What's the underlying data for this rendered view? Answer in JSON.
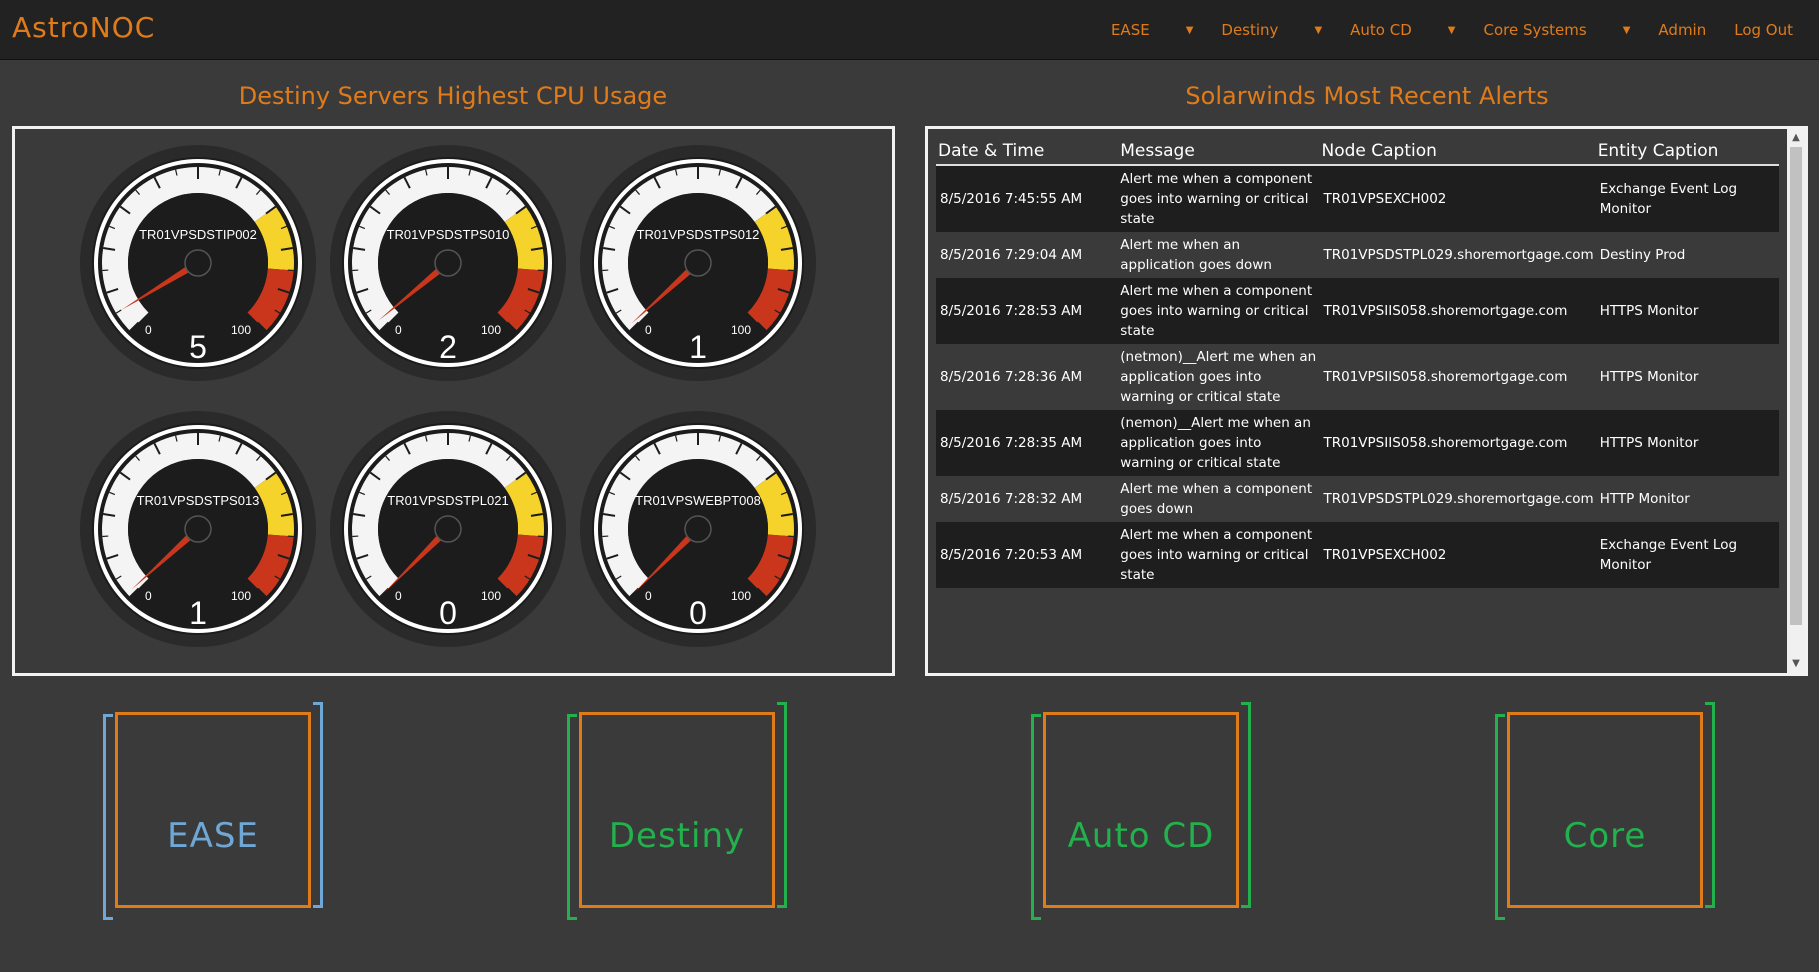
{
  "brand": "AstroNOC",
  "nav": {
    "items": [
      {
        "label": "EASE",
        "dropdown": true
      },
      {
        "label": "Destiny",
        "dropdown": true
      },
      {
        "label": "Auto CD",
        "dropdown": true
      },
      {
        "label": "Core Systems",
        "dropdown": true
      },
      {
        "label": "Admin",
        "dropdown": false
      },
      {
        "label": "Log Out",
        "dropdown": false
      }
    ],
    "caret_icon": "caret-down-icon"
  },
  "cpu_section": {
    "title": "Destiny Servers Highest CPU Usage",
    "gauge_min": "0",
    "gauge_max": "100",
    "gauges": [
      {
        "server": "TR01VPSDSTIP002",
        "value": 5
      },
      {
        "server": "TR01VPSDSTPS010",
        "value": 2
      },
      {
        "server": "TR01VPSDSTPS012",
        "value": 1
      },
      {
        "server": "TR01VPSDSTPS013",
        "value": 1
      },
      {
        "server": "TR01VPSDSTPL021",
        "value": 0
      },
      {
        "server": "TR01VPSWEBPT008",
        "value": 0
      }
    ]
  },
  "alerts_section": {
    "title": "Solarwinds Most Recent Alerts",
    "columns": [
      "Date & Time",
      "Message",
      "Node Caption",
      "Entity Caption"
    ],
    "rows": [
      {
        "datetime": "8/5/2016 7:45:55 AM",
        "message": "Alert me when a component goes into warning or critical state",
        "node": "TR01VPSEXCH002",
        "entity": "Exchange Event Log Monitor"
      },
      {
        "datetime": "8/5/2016 7:29:04 AM",
        "message": "Alert me when an application goes down",
        "node": "TR01VPSDSTPL029.shoremortgage.com",
        "entity": "Destiny Prod"
      },
      {
        "datetime": "8/5/2016 7:28:53 AM",
        "message": "Alert me when a component goes into warning or critical state",
        "node": "TR01VPSIIS058.shoremortgage.com",
        "entity": "HTTPS Monitor"
      },
      {
        "datetime": "8/5/2016 7:28:36 AM",
        "message": "(netmon)__Alert me when an application goes into warning or critical state",
        "node": "TR01VPSIIS058.shoremortgage.com",
        "entity": "HTTPS Monitor"
      },
      {
        "datetime": "8/5/2016 7:28:35 AM",
        "message": "(nemon)__Alert me when an application goes into warning or critical state",
        "node": "TR01VPSIIS058.shoremortgage.com",
        "entity": "HTTPS Monitor"
      },
      {
        "datetime": "8/5/2016 7:28:32 AM",
        "message": "Alert me when a component goes down",
        "node": "TR01VPSDSTPL029.shoremortgage.com",
        "entity": "HTTP Monitor"
      },
      {
        "datetime": "8/5/2016 7:20:53 AM",
        "message": "Alert me when a component goes into warning or critical state",
        "node": "TR01VPSEXCH002",
        "entity": "Exchange Event Log Monitor"
      }
    ]
  },
  "tiles": [
    {
      "label": "EASE",
      "color": "#6fa8d6",
      "bracket_color": "#6fa8d6"
    },
    {
      "label": "Destiny",
      "color": "#22b14c",
      "bracket_color": "#22b14c"
    },
    {
      "label": "Auto CD",
      "color": "#22b14c",
      "bracket_color": "#22b14c"
    },
    {
      "label": "Core",
      "color": "#22b14c",
      "bracket_color": "#22b14c"
    }
  ],
  "colors": {
    "accent": "#e07b1a",
    "gauge_yellow": "#f6d32b",
    "gauge_red": "#c9361b",
    "needle": "#c9361b"
  }
}
